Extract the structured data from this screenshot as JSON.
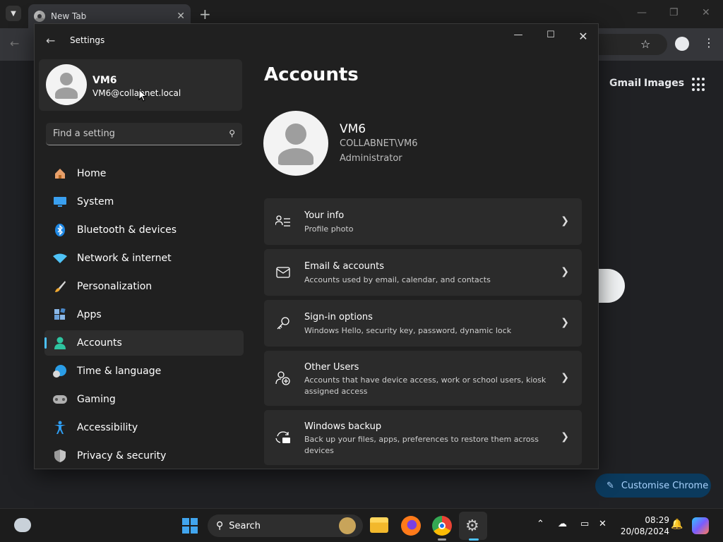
{
  "chrome": {
    "tab_title": "New Tab",
    "tab_close": "✕",
    "new_tab": "+",
    "links": {
      "gmail": "Gmail",
      "images": "Images"
    },
    "customise_label": "Customise Chrome"
  },
  "settings": {
    "app_title": "Settings",
    "profile": {
      "name": "VM6",
      "email": "VM6@collabnet.local"
    },
    "search": {
      "placeholder": "Find a setting"
    },
    "nav": [
      {
        "label": "Home",
        "icon": "home-icon",
        "active": false
      },
      {
        "label": "System",
        "icon": "system-icon",
        "active": false
      },
      {
        "label": "Bluetooth & devices",
        "icon": "bluetooth-icon",
        "active": false
      },
      {
        "label": "Network & internet",
        "icon": "wifi-icon",
        "active": false
      },
      {
        "label": "Personalization",
        "icon": "brush-icon",
        "active": false
      },
      {
        "label": "Apps",
        "icon": "apps-icon",
        "active": false
      },
      {
        "label": "Accounts",
        "icon": "person-icon",
        "active": true
      },
      {
        "label": "Time & language",
        "icon": "globe-icon",
        "active": false
      },
      {
        "label": "Gaming",
        "icon": "gamepad-icon",
        "active": false
      },
      {
        "label": "Accessibility",
        "icon": "accessibility-icon",
        "active": false
      },
      {
        "label": "Privacy & security",
        "icon": "shield-icon",
        "active": false
      }
    ],
    "main": {
      "title": "Accounts",
      "user": {
        "name": "VM6",
        "domain": "COLLABNET\\VM6",
        "role": "Administrator"
      },
      "cards": [
        {
          "title": "Your info",
          "desc": "Profile photo",
          "icon": "person-card-icon"
        },
        {
          "title": "Email & accounts",
          "desc": "Accounts used by email, calendar, and contacts",
          "icon": "mail-icon"
        },
        {
          "title": "Sign-in options",
          "desc": "Windows Hello, security key, password, dynamic lock",
          "icon": "key-icon"
        },
        {
          "title": "Other Users",
          "desc": "Accounts that have device access, work or school users, kiosk assigned access",
          "icon": "add-user-icon"
        },
        {
          "title": "Windows backup",
          "desc": "Back up your files, apps, preferences to restore them across devices",
          "icon": "backup-icon"
        }
      ]
    }
  },
  "taskbar": {
    "search_label": "Search",
    "time": "08:29",
    "date": "20/08/2024"
  }
}
